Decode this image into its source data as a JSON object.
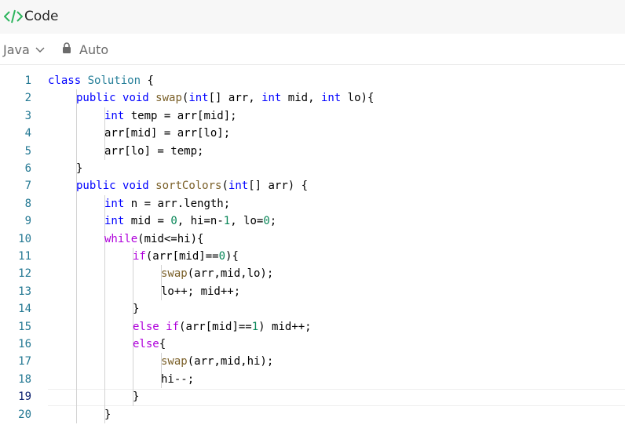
{
  "header": {
    "title": "Code",
    "icon": "code-icon"
  },
  "toolbar": {
    "language": "Java",
    "mode": "Auto"
  },
  "editor": {
    "active_line": 19,
    "lines": [
      {
        "n": "1",
        "indent": 0,
        "tokens": [
          {
            "t": "class",
            "c": "kw"
          },
          {
            "t": " "
          },
          {
            "t": "Solution",
            "c": "ty"
          },
          {
            "t": " {"
          }
        ]
      },
      {
        "n": "2",
        "indent": 1,
        "tokens": [
          {
            "t": "public",
            "c": "kw"
          },
          {
            "t": " "
          },
          {
            "t": "void",
            "c": "kw"
          },
          {
            "t": " "
          },
          {
            "t": "swap",
            "c": "fn"
          },
          {
            "t": "("
          },
          {
            "t": "int",
            "c": "kw"
          },
          {
            "t": "[] arr, "
          },
          {
            "t": "int",
            "c": "kw"
          },
          {
            "t": " mid, "
          },
          {
            "t": "int",
            "c": "kw"
          },
          {
            "t": " lo){"
          }
        ]
      },
      {
        "n": "3",
        "indent": 2,
        "tokens": [
          {
            "t": "int",
            "c": "kw"
          },
          {
            "t": " temp = arr[mid];"
          }
        ]
      },
      {
        "n": "4",
        "indent": 2,
        "tokens": [
          {
            "t": "arr[mid] = arr[lo];"
          }
        ]
      },
      {
        "n": "5",
        "indent": 2,
        "tokens": [
          {
            "t": "arr[lo] = temp;"
          }
        ]
      },
      {
        "n": "6",
        "indent": 1,
        "tokens": [
          {
            "t": "}"
          }
        ]
      },
      {
        "n": "7",
        "indent": 1,
        "tokens": [
          {
            "t": "public",
            "c": "kw"
          },
          {
            "t": " "
          },
          {
            "t": "void",
            "c": "kw"
          },
          {
            "t": " "
          },
          {
            "t": "sortColors",
            "c": "fn"
          },
          {
            "t": "("
          },
          {
            "t": "int",
            "c": "kw"
          },
          {
            "t": "[] arr) {"
          }
        ]
      },
      {
        "n": "8",
        "indent": 2,
        "tokens": [
          {
            "t": "int",
            "c": "kw"
          },
          {
            "t": " n = arr.length;"
          }
        ]
      },
      {
        "n": "9",
        "indent": 2,
        "tokens": [
          {
            "t": "int",
            "c": "kw"
          },
          {
            "t": " mid = "
          },
          {
            "t": "0",
            "c": "num"
          },
          {
            "t": ", hi=n-"
          },
          {
            "t": "1",
            "c": "num"
          },
          {
            "t": ", lo="
          },
          {
            "t": "0",
            "c": "num"
          },
          {
            "t": ";"
          }
        ]
      },
      {
        "n": "10",
        "indent": 2,
        "tokens": [
          {
            "t": "while",
            "c": "ctrl"
          },
          {
            "t": "(mid<=hi){"
          }
        ]
      },
      {
        "n": "11",
        "indent": 3,
        "tokens": [
          {
            "t": "if",
            "c": "ctrl"
          },
          {
            "t": "(arr[mid]=="
          },
          {
            "t": "0",
            "c": "num"
          },
          {
            "t": "){"
          }
        ]
      },
      {
        "n": "12",
        "indent": 4,
        "tokens": [
          {
            "t": "swap",
            "c": "fn"
          },
          {
            "t": "(arr,mid,lo);"
          }
        ]
      },
      {
        "n": "13",
        "indent": 4,
        "tokens": [
          {
            "t": "lo++; mid++;"
          }
        ]
      },
      {
        "n": "14",
        "indent": 3,
        "tokens": [
          {
            "t": "}"
          }
        ]
      },
      {
        "n": "15",
        "indent": 3,
        "tokens": [
          {
            "t": "else",
            "c": "ctrl"
          },
          {
            "t": " "
          },
          {
            "t": "if",
            "c": "ctrl"
          },
          {
            "t": "(arr[mid]=="
          },
          {
            "t": "1",
            "c": "num"
          },
          {
            "t": ") mid++;"
          }
        ]
      },
      {
        "n": "16",
        "indent": 3,
        "tokens": [
          {
            "t": "else",
            "c": "ctrl"
          },
          {
            "t": "{"
          }
        ]
      },
      {
        "n": "17",
        "indent": 4,
        "tokens": [
          {
            "t": "swap",
            "c": "fn"
          },
          {
            "t": "(arr,mid,hi);"
          }
        ]
      },
      {
        "n": "18",
        "indent": 4,
        "tokens": [
          {
            "t": "hi--;"
          }
        ]
      },
      {
        "n": "19",
        "indent": 3,
        "tokens": [
          {
            "t": "}"
          }
        ]
      },
      {
        "n": "20",
        "indent": 2,
        "tokens": [
          {
            "t": "}"
          }
        ]
      }
    ]
  }
}
